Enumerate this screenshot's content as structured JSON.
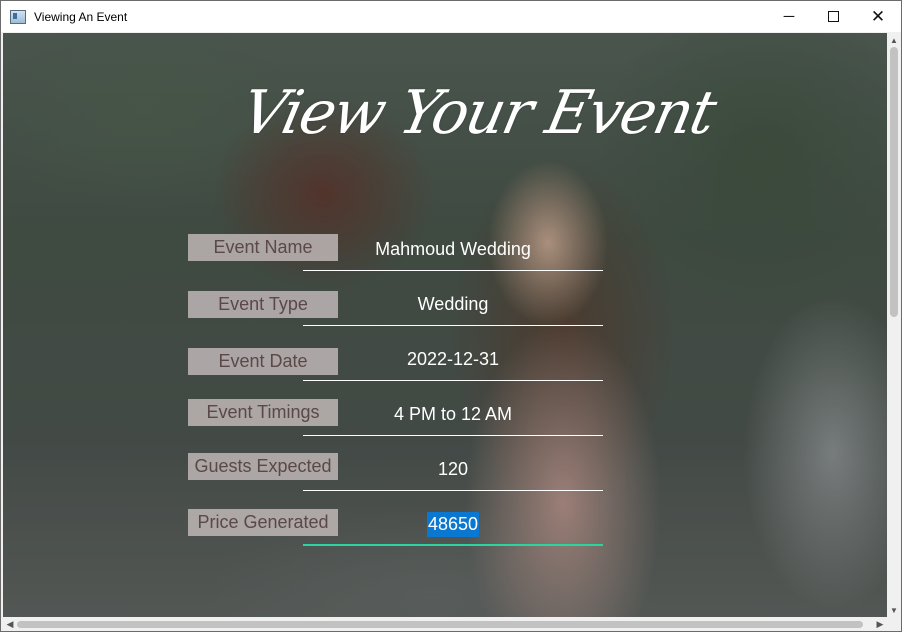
{
  "window": {
    "title": "Viewing An Event",
    "icon": "app-window-icon",
    "controls": {
      "minimize": "─",
      "maximize": "",
      "close": "✕"
    }
  },
  "hero": {
    "title": "View Your Event"
  },
  "fields": [
    {
      "label": "Event Name",
      "value": "Mahmoud Wedding"
    },
    {
      "label": "Event Type",
      "value": "Wedding"
    },
    {
      "label": "Event Date",
      "value": "2022-12-31"
    },
    {
      "label": "Event Timings",
      "value": "4 PM to 12 AM"
    },
    {
      "label": "Guests Expected",
      "value": "120"
    },
    {
      "label": "Price Generated",
      "value": "48650",
      "selected": true
    }
  ],
  "colors": {
    "label_bg": "#beb6b6",
    "label_text": "#5b4848",
    "selection": "#0a78d0",
    "active_underline": "#2ed4a0"
  }
}
